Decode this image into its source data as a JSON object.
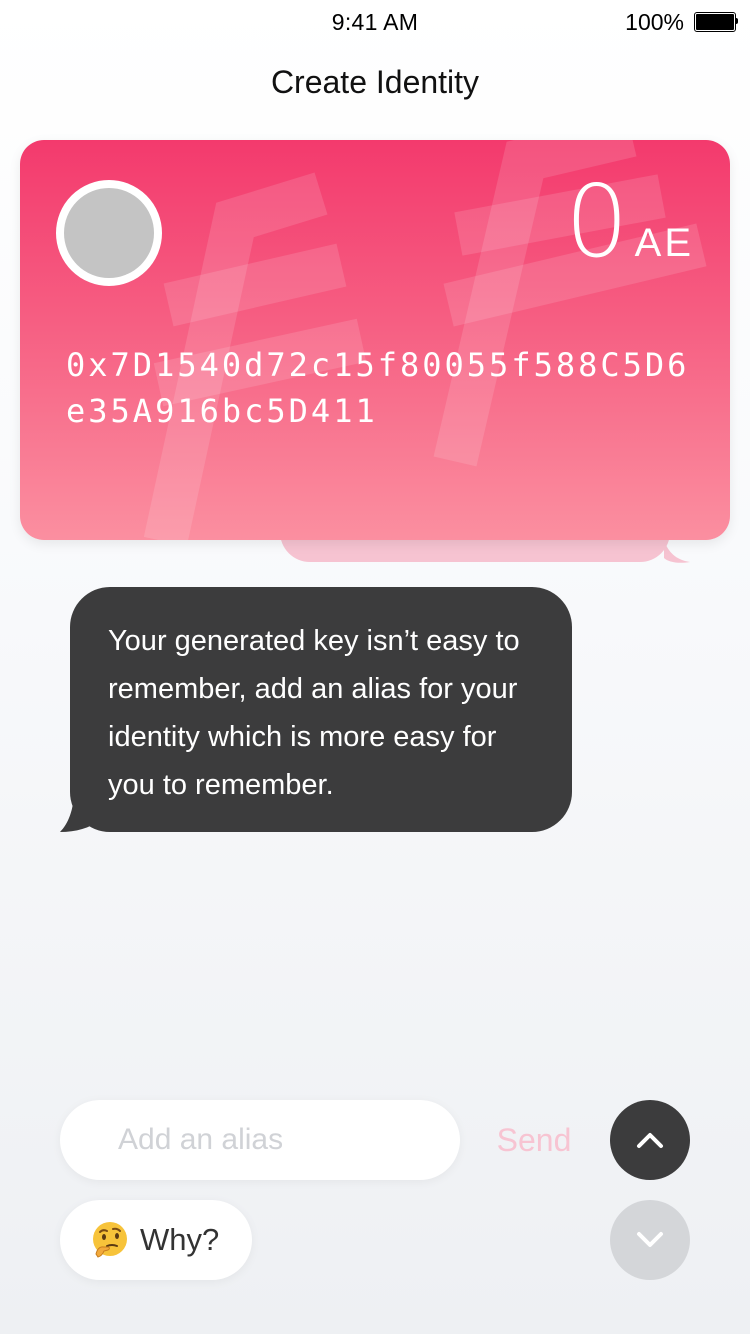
{
  "status_bar": {
    "time": "9:41 AM",
    "battery_percent": "100%",
    "battery_level": 1.0
  },
  "header": {
    "title": "Create Identity"
  },
  "identity_card": {
    "balance": "0",
    "currency": "AE",
    "address": "0x7D1540d72c15f80055f588C5D6e35A916bc5D411",
    "colors": {
      "gradient_top": "#f33a6d",
      "gradient_bottom": "#fb8fa0",
      "avatar": "#c4c4c4"
    }
  },
  "chat": {
    "message": "Your generated key isn’t easy to remember, add an alias for your identity which is more easy for you to remember."
  },
  "composer": {
    "alias_placeholder": "Add an alias",
    "alias_value": "",
    "send_label": "Send",
    "why_label": "Why?",
    "why_icon": "thinking-face-icon",
    "scroll_up_icon": "chevron-up-icon",
    "scroll_down_icon": "chevron-down-icon"
  },
  "colors": {
    "dark_bubble": "#3c3c3d",
    "send_disabled": "#f7c4d2",
    "button_disabled": "#d4d6d9"
  }
}
